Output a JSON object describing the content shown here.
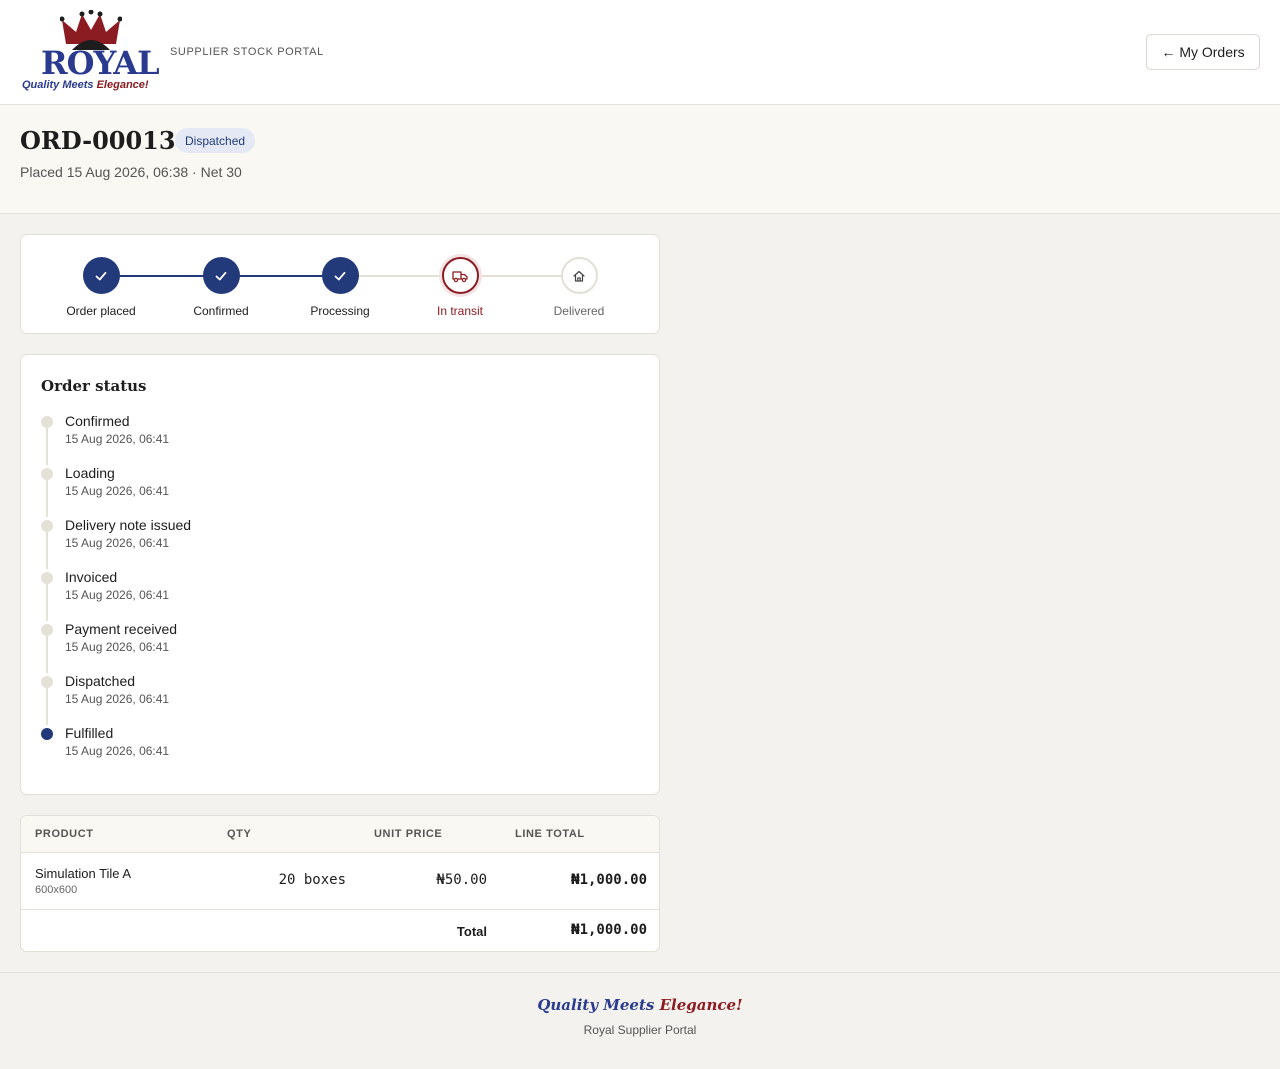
{
  "header": {
    "brand": "ROYAL",
    "tagline_part1": "Quality Meets",
    "tagline_part2": "Elegance!",
    "portal_name": "SUPPLIER STOCK PORTAL",
    "my_orders_label": "My Orders",
    "my_orders_arrow": "←"
  },
  "order": {
    "id": "ORD-00013",
    "status": "Dispatched",
    "placed": "Placed 15 Aug 2026, 06:38 · Net 30"
  },
  "progress": {
    "steps": [
      {
        "label": "Order placed",
        "state": "done",
        "icon": "check-icon"
      },
      {
        "label": "Confirmed",
        "state": "done",
        "icon": "check-icon"
      },
      {
        "label": "Processing",
        "state": "done",
        "icon": "check-icon"
      },
      {
        "label": "In transit",
        "state": "current",
        "icon": "truck-icon"
      },
      {
        "label": "Delivered",
        "state": "pending",
        "icon": "house-icon"
      }
    ]
  },
  "status_card": {
    "title": "Order status",
    "events": [
      {
        "event": "Confirmed",
        "time": "15 Aug 2026, 06:41"
      },
      {
        "event": "Loading",
        "time": "15 Aug 2026, 06:41"
      },
      {
        "event": "Delivery note issued",
        "time": "15 Aug 2026, 06:41"
      },
      {
        "event": "Invoiced",
        "time": "15 Aug 2026, 06:41"
      },
      {
        "event": "Payment received",
        "time": "15 Aug 2026, 06:41"
      },
      {
        "event": "Dispatched",
        "time": "15 Aug 2026, 06:41"
      },
      {
        "event": "Fulfilled",
        "time": "15 Aug 2026, 06:41"
      }
    ]
  },
  "items": {
    "columns": [
      "PRODUCT",
      "QTY",
      "UNIT PRICE",
      "LINE TOTAL"
    ],
    "rows": [
      {
        "product": "Simulation Tile A",
        "size": "600x600",
        "qty": "20 boxes",
        "unit_price": "₦50.00",
        "line_total": "₦1,000.00"
      }
    ],
    "total_label": "Total",
    "total_value": "₦1,000.00"
  },
  "footer": {
    "slogan_part1": "Quality Meets",
    "slogan_part2": "Elegance!",
    "name": "Royal Supplier Portal"
  },
  "colors": {
    "navy": "#22397a",
    "maroon": "#8b1c22",
    "pending": "#e1dfd6"
  }
}
